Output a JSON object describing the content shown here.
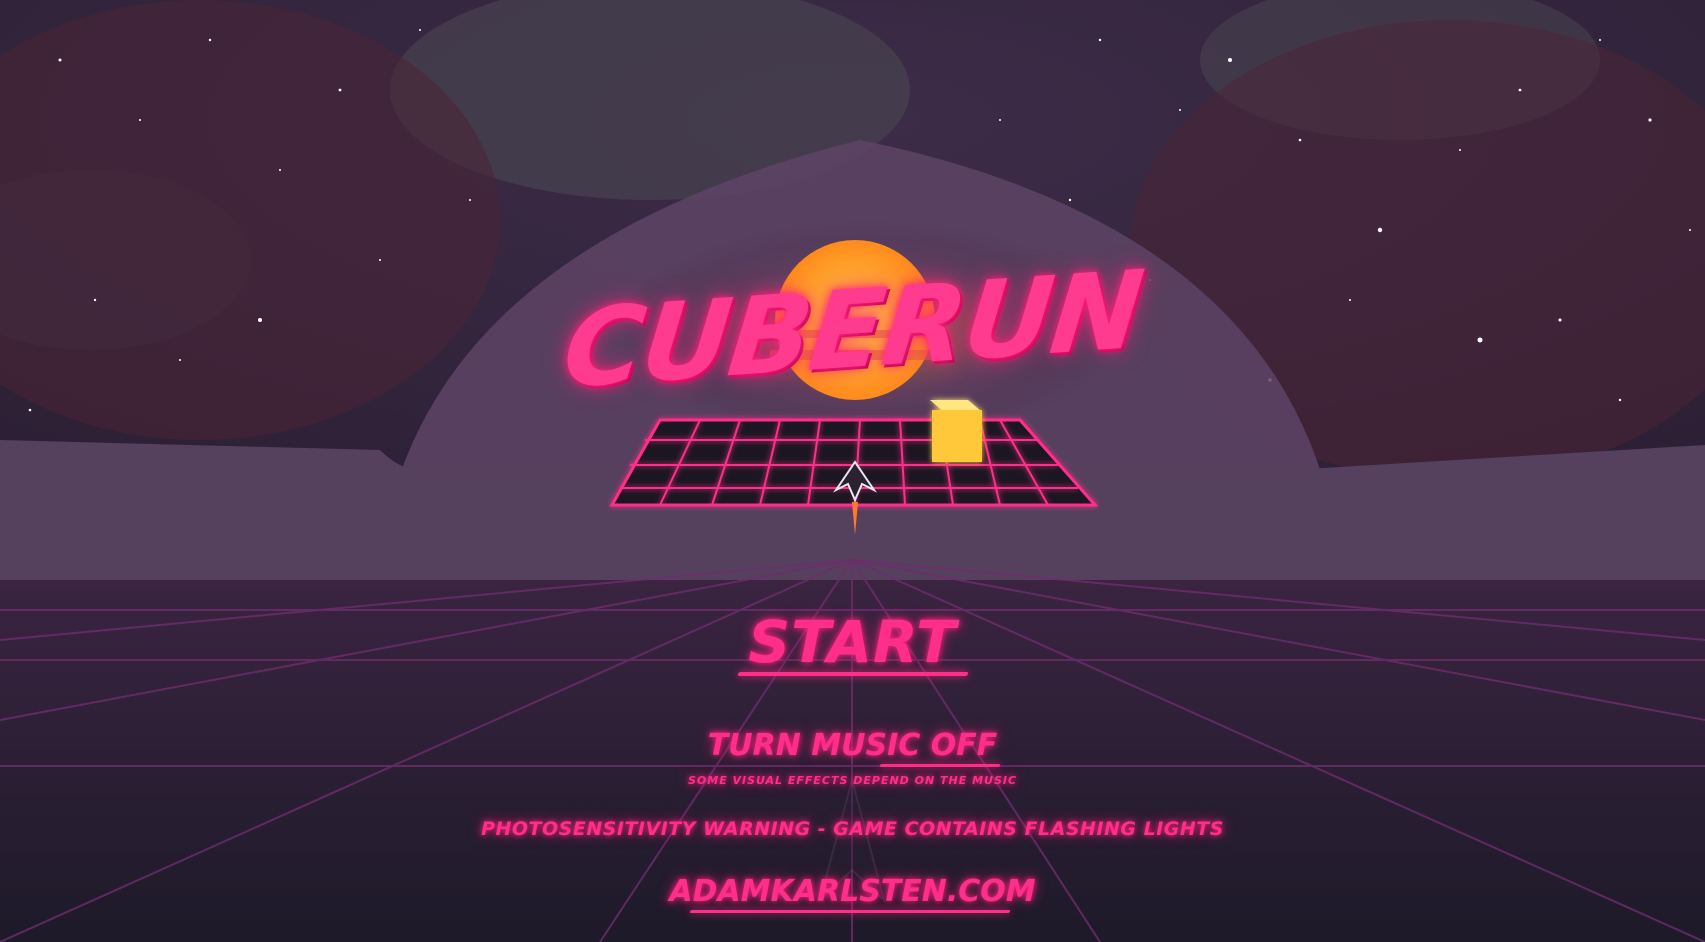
{
  "logo": {
    "title": "CUBERUN"
  },
  "menu": {
    "start_label": "START",
    "music_label": "TURN MUSIC OFF",
    "music_hint": "SOME VISUAL EFFECTS DEPEND ON THE MUSIC",
    "warning": "PHOTOSENSITIVITY WARNING - GAME CONTAINS FLASHING LIGHTS",
    "website": "ADAMKARLSTEN.COM"
  },
  "colors": {
    "neon_pink": "#ff2e8a",
    "sun": "#ffb020",
    "cube": "#ffd23a",
    "grid": "#7a2a78",
    "background": "#1c1a2a"
  }
}
